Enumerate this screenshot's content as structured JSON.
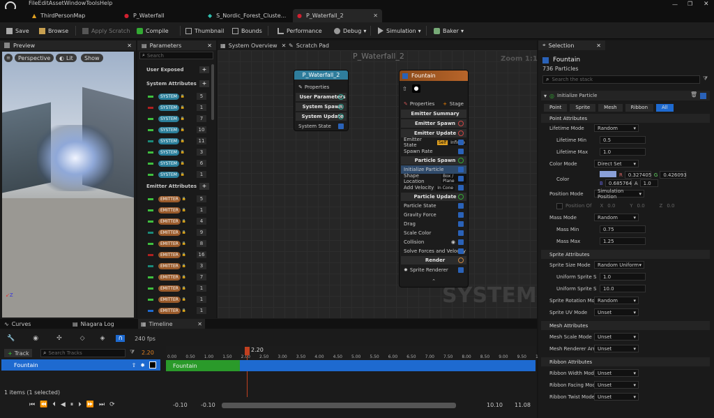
{
  "menu": [
    "File",
    "Edit",
    "Asset",
    "Window",
    "Tools",
    "Help"
  ],
  "tabs": [
    "ThirdPersonMap",
    "P_Waterfall",
    "S_Nordic_Forest_Cluste...",
    "P_Waterfall_2"
  ],
  "toolbar": {
    "save": "Save",
    "browse": "Browse",
    "apply_scratch": "Apply Scratch",
    "compile": "Compile",
    "thumbnail": "Thumbnail",
    "bounds": "Bounds",
    "performance": "Performance",
    "debug": "Debug",
    "simulation": "Simulation",
    "baker": "Baker"
  },
  "preview": {
    "title": "Preview",
    "perspective": "Perspective",
    "lit": "Lit",
    "show": "Show"
  },
  "params": {
    "title": "Parameters",
    "search_placeholder": "Search",
    "user_exposed": "User Exposed",
    "system_attributes": "System Attributes",
    "emitter_attributes": "Emitter Attributes",
    "system_tag": "SYSTEM",
    "emitter_tag": "EMITTER",
    "system_counts": [
      "5",
      "1",
      "7",
      "10",
      "11",
      "3",
      "6",
      "1"
    ],
    "emitter_counts": [
      "5",
      "1",
      "4",
      "9",
      "8",
      "16",
      "3",
      "7",
      "1",
      "1",
      "1"
    ],
    "system_colors": [
      "#3fbf3f",
      "#b02020",
      "#3fbf3f",
      "#3fbf3f",
      "#1a8a7a",
      "#3fbf3f",
      "#3fbf3f",
      "#3fbf3f"
    ],
    "emitter_colors": [
      "#3fbf3f",
      "#3fbf3f",
      "#3fbf3f",
      "#1a8a7a",
      "#3fbf3f",
      "#b02020",
      "#1a8a7a",
      "#3fbf3f",
      "#3fbf3f",
      "#3fbf3f",
      "#1e6ad0"
    ]
  },
  "graph": {
    "tab_overview": "System Overview",
    "tab_scratch": "Scratch Pad",
    "title": "P_Waterfall_2",
    "zoom": "Zoom 1:1",
    "watermark": "SYSTEM",
    "system_node": {
      "title": "P_Waterfall_2",
      "properties": "Properties",
      "user_parameters": "User Parameters",
      "system_spawn": "System Spawn",
      "system_update": "System Update",
      "system_state": "System State"
    },
    "emitter_node": {
      "title": "Fountain",
      "properties": "Properties",
      "stage": "Stage",
      "summary": "Emitter Summary",
      "spawn": "Emitter Spawn",
      "update": "Emitter Update",
      "emitter_state": "Emitter State",
      "self": "Self",
      "infinite": "Infinite",
      "spawn_rate": "Spawn Rate",
      "particle_spawn": "Particle Spawn",
      "init_particle": "Initialize Particle",
      "shape_location": "Shape Location",
      "box_plane": "Box / Plane",
      "add_velocity": "Add Velocity",
      "in_cone": "In Cone",
      "particle_update": "Particle Update",
      "particle_state": "Particle State",
      "gravity": "Gravity Force",
      "drag": "Drag",
      "scale_color": "Scale Color",
      "collision": "Collision",
      "solve": "Solve Forces and Velocity",
      "render": "Render",
      "sprite_renderer": "Sprite Renderer"
    }
  },
  "selection": {
    "title": "Selection",
    "emitter": "Fountain",
    "count": "736 Particles",
    "search_placeholder": "Search the stack",
    "module": "Initialize Particle",
    "filters": [
      "Point",
      "Sprite",
      "Mesh",
      "Ribbon",
      "All"
    ],
    "point_attributes": "Point Attributes",
    "lifetime_mode": "Lifetime Mode",
    "lifetime_mode_val": "Random",
    "lifetime_min": "Lifetime Min",
    "lifetime_min_val": "0.5",
    "lifetime_max": "Lifetime Max",
    "lifetime_max_val": "1.0",
    "color_mode": "Color Mode",
    "color_mode_val": "Direct Set",
    "color": "Color",
    "r": "0.327405",
    "g": "0.426093",
    "b": "0.685764",
    "a": "1.0",
    "position_mode": "Position Mode",
    "position_mode_val": "Simulation Position",
    "position_offset": "Position Of",
    "px": "0.0",
    "py": "0.0",
    "pz": "0.0",
    "mass_mode": "Mass Mode",
    "mass_mode_val": "Random",
    "mass_min": "Mass Min",
    "mass_min_val": "0.75",
    "mass_max": "Mass Max",
    "mass_max_val": "1.25",
    "sprite_attributes": "Sprite Attributes",
    "sprite_size_mode": "Sprite Size Mode",
    "sprite_size_mode_val": "Random Uniform",
    "uniform_min": "Uniform Sprite S",
    "uniform_min_val": "1.0",
    "uniform_max": "Uniform Sprite S",
    "uniform_max_val": "10.0",
    "sprite_rot": "Sprite Rotation Moc",
    "sprite_rot_val": "Random",
    "sprite_uv": "Sprite UV Mode",
    "sprite_uv_val": "Unset",
    "mesh_attributes": "Mesh Attributes",
    "mesh_scale": "Mesh Scale Mode",
    "mesh_scale_val": "Unset",
    "mesh_renderer": "Mesh Renderer Arra",
    "mesh_renderer_val": "Unset",
    "ribbon_attributes": "Ribbon Attributes",
    "ribbon_width": "Ribbon Width Mode",
    "ribbon_width_val": "Unset",
    "ribbon_facing": "Ribbon Facing Mod",
    "ribbon_facing_val": "Unset",
    "ribbon_twist": "Ribbon Twist Mode",
    "ribbon_twist_val": "Unset"
  },
  "bottom": {
    "curves": "Curves",
    "log": "Niagara Log",
    "timeline": "Timeline",
    "fps": "240 fps",
    "current": "2.20",
    "track": "Track",
    "search_tracks": "Search Tracks",
    "track_time": "2.20",
    "track_name": "Fountain",
    "clip": "Fountain",
    "items": "1 items (1 selected)",
    "ticks": [
      "0.00",
      "0.50",
      "1.00",
      "1.50",
      "2.00",
      "2.50",
      "3.00",
      "3.50",
      "4.00",
      "4.50",
      "5.00",
      "5.50",
      "6.00",
      "6.50",
      "7.00",
      "7.50",
      "8.00",
      "8.50",
      "9.00",
      "9.50",
      "1"
    ],
    "range_start": "-0.10",
    "range_start2": "-0.10",
    "range_end": "10.10",
    "range_end2": "11.08"
  }
}
